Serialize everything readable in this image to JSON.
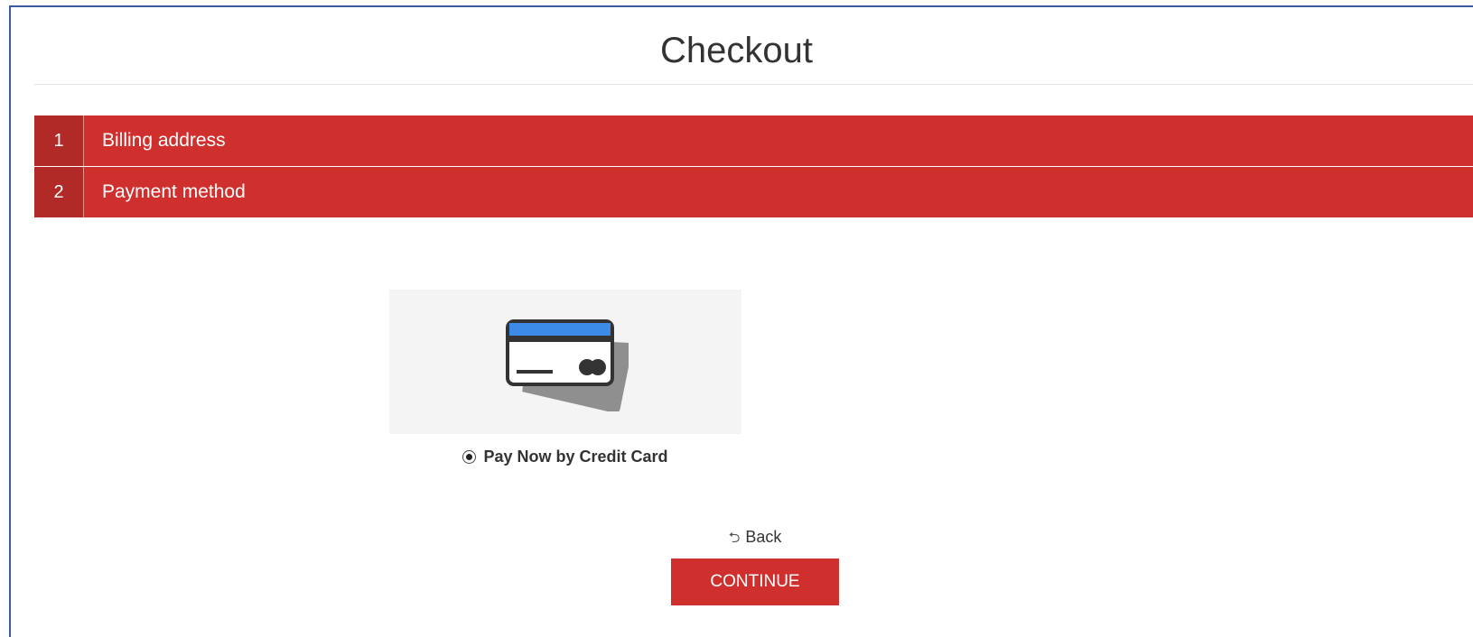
{
  "page": {
    "title": "Checkout"
  },
  "steps": [
    {
      "number": "1",
      "label": "Billing address"
    },
    {
      "number": "2",
      "label": "Payment method"
    }
  ],
  "payment_method": {
    "option_label": "Pay Now by Credit Card",
    "selected": true,
    "icon": "credit-card-icon"
  },
  "actions": {
    "back_icon": "back-arrow-icon",
    "back_label": "Back",
    "continue_label": "CONTINUE"
  },
  "colors": {
    "accent": "#d0302d",
    "accent_dark": "#b22a27",
    "card_stripe": "#3d8be8"
  }
}
